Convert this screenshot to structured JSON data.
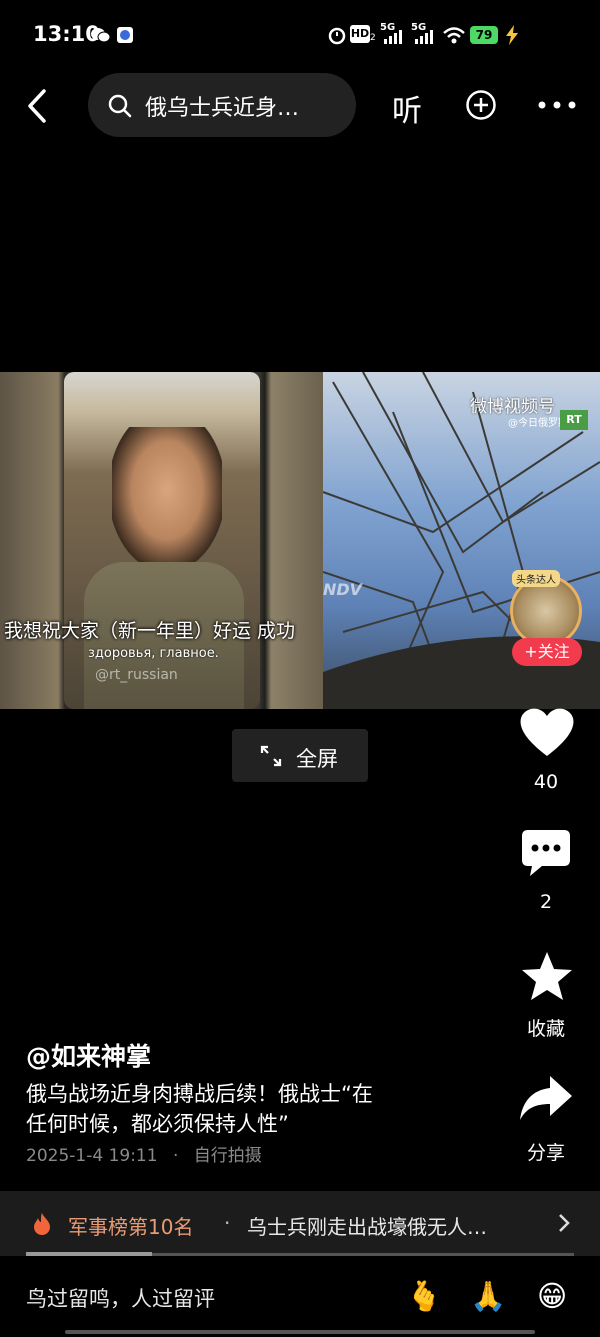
{
  "status_bar": {
    "time": "13:10",
    "signal_1": "5G",
    "signal_2": "5G",
    "battery": "79",
    "hd_label": "HD",
    "hd_sub": "2"
  },
  "nav": {
    "search_query": "俄乌士兵近身…",
    "listen_label": "听"
  },
  "video": {
    "watermark": "RT",
    "subtitle_zh": "我想祝大家（新一年里）好运 成功",
    "subtitle_ru": "здоровья, главное.",
    "telegram_handle": "@rt_russian",
    "weibo_logo": "微博视频号",
    "weibo_account": "@今日俄罗斯",
    "rt_badge": "RT",
    "ndv_mark": "NDV",
    "avatar_badge": "头条达人",
    "follow_label": "+关注"
  },
  "fullscreen": {
    "label": "全屏"
  },
  "actions": {
    "like_count": "40",
    "comment_count": "2",
    "favorite_label": "收藏",
    "share_label": "分享"
  },
  "post": {
    "author": "@如来神掌",
    "caption_line1": "俄乌战场近身肉搏战后续！俄战士“在",
    "caption_line2": "任何时候，都必须保持人性”",
    "date": "2025-1-4 19:11",
    "dot": "·",
    "source": "自行拍摄"
  },
  "trending": {
    "rank": "军事榜第10名",
    "separator": "·",
    "text": "乌士兵刚走出战壕俄无人…",
    "progress": 0.23
  },
  "comment_bar": {
    "placeholder": "鸟过留鸣，人过留评",
    "emoji_1": "🫰",
    "emoji_2": "🙏",
    "emoji_3": "😁"
  },
  "colors": {
    "accent_red": "#f23c4e",
    "trend_orange": "#e89b74",
    "battery_green": "#4cd964"
  }
}
